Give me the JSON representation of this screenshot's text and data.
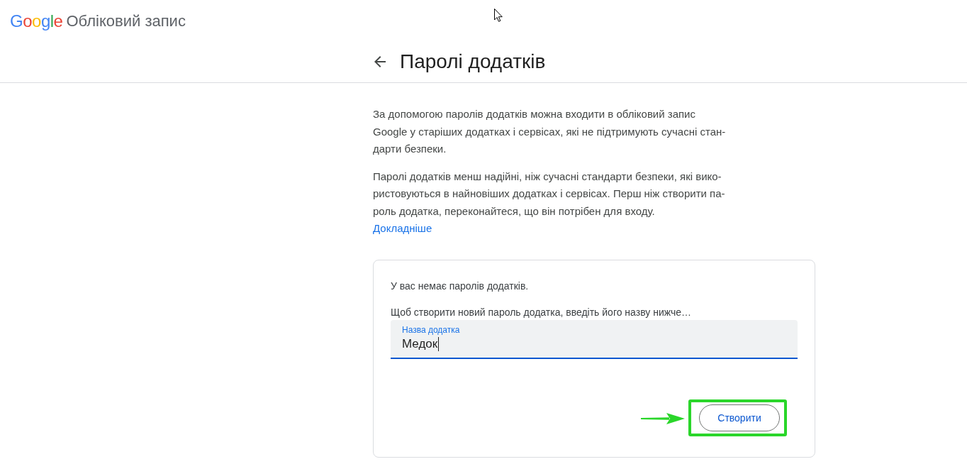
{
  "header": {
    "logo": "Google",
    "product": "Обліковий запис"
  },
  "page": {
    "title": "Паролі додатків"
  },
  "intro": {
    "paragraphs": [
      [
        "За допомогою паролів додатків можна входити в обліковий запис",
        "Google у старіших додатках і сервісах, які не підтримують сучасні стан-",
        "дарти безпеки."
      ],
      [
        "Паролі додатків менш надійні, ніж сучасні стандарти безпеки, які вико-",
        "ристовуються в найновіших додатках і сервісах. Перш ніж створити па-",
        "роль додатка, переконайтеся, що він потрібен для входу."
      ]
    ],
    "link": "Докладніше"
  },
  "card": {
    "status": "У вас немає паролів додатків.",
    "hint": "Щоб створити новий пароль додатка, введіть його назву нижче…",
    "field": {
      "label": "Назва додатка",
      "value": "Медок",
      "focused": true
    },
    "button": {
      "label": "Створити",
      "highlighted": true
    }
  }
}
